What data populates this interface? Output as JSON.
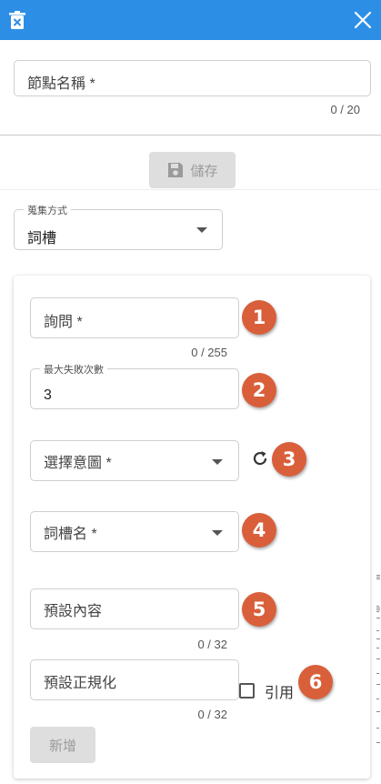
{
  "header": {
    "color": "#2d8ee6",
    "delete_icon": "trash-icon",
    "close_icon": "close-icon"
  },
  "node_name": {
    "placeholder": "節點名稱 *",
    "counter": "0 / 20"
  },
  "toolbar": {
    "save_label": "儲存",
    "save_icon": "floppy-disk-icon"
  },
  "collection": {
    "label": "蒐集方式",
    "value": "詞槽"
  },
  "form": {
    "question": {
      "placeholder": "詢問 *",
      "counter": "0 / 255"
    },
    "max_fail": {
      "label": "最大失敗次數",
      "value": "3"
    },
    "intent": {
      "placeholder": "選擇意圖 *"
    },
    "slot_name": {
      "placeholder": "詞槽名 *"
    },
    "default_content": {
      "placeholder": "預設內容",
      "counter": "0 / 32"
    },
    "default_regex": {
      "placeholder": "預設正規化",
      "counter": "0 / 32"
    },
    "reference_label": "引用",
    "add_label": "新增"
  },
  "badges": [
    "1",
    "2",
    "3",
    "4",
    "5",
    "6"
  ],
  "badge_color": "#d95f3b"
}
